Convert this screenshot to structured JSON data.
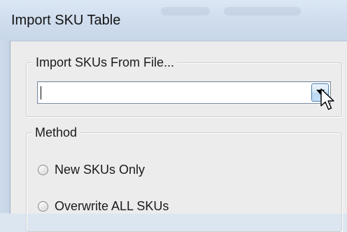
{
  "window": {
    "title": "Import SKU Table"
  },
  "file_group": {
    "legend": "Import SKUs From File...",
    "combo_value": "",
    "dropdown_icon": "chevron-down-icon"
  },
  "method_group": {
    "legend": "Method",
    "options": [
      {
        "label": "New SKUs Only",
        "selected": false
      },
      {
        "label": "Overwrite ALL SKUs",
        "selected": false
      }
    ]
  },
  "colors": {
    "titlebar": "#cfdced",
    "dialog_background": "#ececec",
    "combo_border": "#7a8ea3",
    "dropdown_button_border": "#4f7fb0"
  }
}
